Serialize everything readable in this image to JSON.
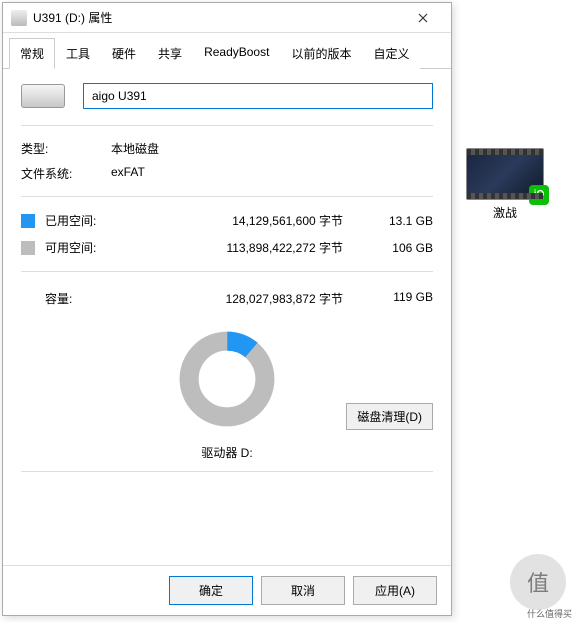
{
  "window": {
    "title": "U391 (D:) 属性",
    "close_glyph": "×"
  },
  "tabs": [
    "常规",
    "工具",
    "硬件",
    "共享",
    "ReadyBoost",
    "以前的版本",
    "自定义"
  ],
  "active_tab": 0,
  "drive": {
    "name_value": "aigo U391",
    "type_label": "类型:",
    "type_value": "本地磁盘",
    "fs_label": "文件系统:",
    "fs_value": "exFAT",
    "used_label": "已用空间:",
    "used_bytes": "14,129,561,600 字节",
    "used_gb": "13.1 GB",
    "free_label": "可用空间:",
    "free_bytes": "113,898,422,272 字节",
    "free_gb": "106 GB",
    "capacity_label": "容量:",
    "capacity_bytes": "128,027,983,872 字节",
    "capacity_gb": "119 GB",
    "drive_label": "驱动器 D:",
    "cleanup_button": "磁盘清理(D)"
  },
  "buttons": {
    "ok": "确定",
    "cancel": "取消",
    "apply": "应用(A)"
  },
  "desktop_file": {
    "name": "激战",
    "badge": "iQ"
  },
  "watermark": {
    "main": "值",
    "sub": "什么值得买"
  },
  "colors": {
    "used": "#2196f3",
    "free": "#bdbdbd",
    "accent": "#0078d7"
  },
  "chart_data": {
    "type": "pie",
    "title": "",
    "categories": [
      "已用空间",
      "可用空间"
    ],
    "values": [
      13.1,
      106
    ],
    "colors": [
      "#2196f3",
      "#bdbdbd"
    ],
    "donut": true
  }
}
